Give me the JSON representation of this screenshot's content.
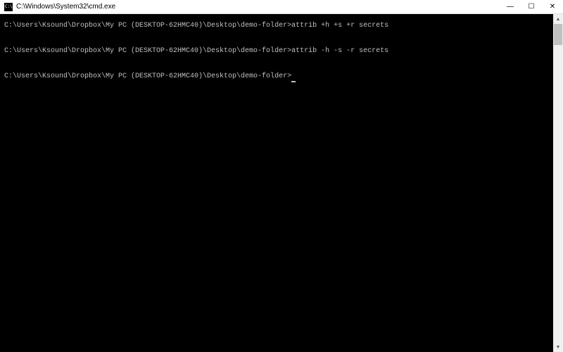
{
  "window": {
    "title": "C:\\Windows\\System32\\cmd.exe"
  },
  "terminal": {
    "prompt": "C:\\Users\\Ksound\\Dropbox\\My PC (DESKTOP-62HMC40)\\Desktop\\demo-folder>",
    "lines": [
      {
        "prompt": "C:\\Users\\Ksound\\Dropbox\\My PC (DESKTOP-62HMC40)\\Desktop\\demo-folder>",
        "command": "attrib +h +s +r secrets"
      },
      {
        "prompt": "C:\\Users\\Ksound\\Dropbox\\My PC (DESKTOP-62HMC40)\\Desktop\\demo-folder>",
        "command": "attrib -h -s -r secrets"
      },
      {
        "prompt": "C:\\Users\\Ksound\\Dropbox\\My PC (DESKTOP-62HMC40)\\Desktop\\demo-folder>",
        "command": ""
      }
    ]
  },
  "controls": {
    "minimize": "—",
    "maximize": "☐",
    "close": "✕"
  },
  "scroll": {
    "up": "▲",
    "down": "▼"
  }
}
